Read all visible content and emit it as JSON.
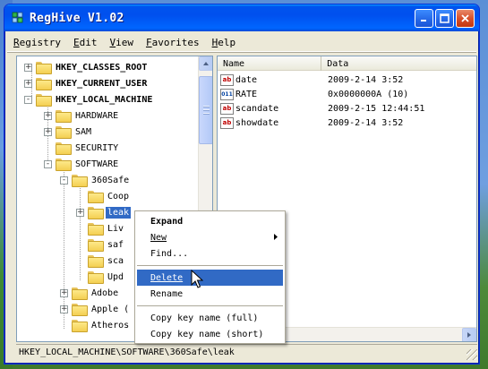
{
  "window": {
    "title": "RegHive V1.02"
  },
  "menubar": [
    {
      "label": "Registry",
      "accel": "R"
    },
    {
      "label": "Edit",
      "accel": "E"
    },
    {
      "label": "View",
      "accel": "V"
    },
    {
      "label": "Favorites",
      "accel": "F"
    },
    {
      "label": "Help",
      "accel": "H"
    }
  ],
  "tree": {
    "nodes": [
      {
        "label": "HKEY_CLASSES_ROOT",
        "bold": true,
        "expander": "+"
      },
      {
        "label": "HKEY_CURRENT_USER",
        "bold": true,
        "expander": "+"
      },
      {
        "label": "HKEY_LOCAL_MACHINE",
        "bold": true,
        "expander": "-"
      },
      {
        "label": "HARDWARE",
        "expander": "+"
      },
      {
        "label": "SAM",
        "expander": "+"
      },
      {
        "label": "SECURITY",
        "expander": ""
      },
      {
        "label": "SOFTWARE",
        "expander": "-"
      },
      {
        "label": "360Safe",
        "expander": "-"
      },
      {
        "label": "Coop",
        "expander": ""
      },
      {
        "label": "leak",
        "expander": "+",
        "selected": true
      },
      {
        "label": "Liv",
        "expander": ""
      },
      {
        "label": "saf",
        "expander": ""
      },
      {
        "label": "sca",
        "expander": ""
      },
      {
        "label": "Upd",
        "expander": ""
      },
      {
        "label": "Adobe",
        "expander": "+"
      },
      {
        "label": "Apple (",
        "expander": "+"
      },
      {
        "label": "Atheros",
        "expander": ""
      }
    ]
  },
  "list": {
    "columns": [
      "Name",
      "Data"
    ],
    "rows": [
      {
        "name": "date",
        "data": "2009-2-14 3:52",
        "type": "sz"
      },
      {
        "name": "RATE",
        "data": "0x0000000A (10)",
        "type": "dword"
      },
      {
        "name": "scandate",
        "data": "2009-2-15 12:44:51",
        "type": "sz"
      },
      {
        "name": "showdate",
        "data": "2009-2-14 3:52",
        "type": "sz"
      }
    ],
    "icon_text": {
      "sz": "ab",
      "dword": "011"
    }
  },
  "context_menu": {
    "expand": "Expand",
    "new": "New",
    "find": "Find...",
    "delete": "Delete",
    "rename": "Rename",
    "copy_full": "Copy key name (full)",
    "copy_short": "Copy key name (short)"
  },
  "statusbar": {
    "path": "HKEY_LOCAL_MACHINE\\SOFTWARE\\360Safe\\leak"
  },
  "colors": {
    "titlebar": "#0053ee",
    "selection": "#316ac5",
    "window_face": "#ece9d8"
  }
}
